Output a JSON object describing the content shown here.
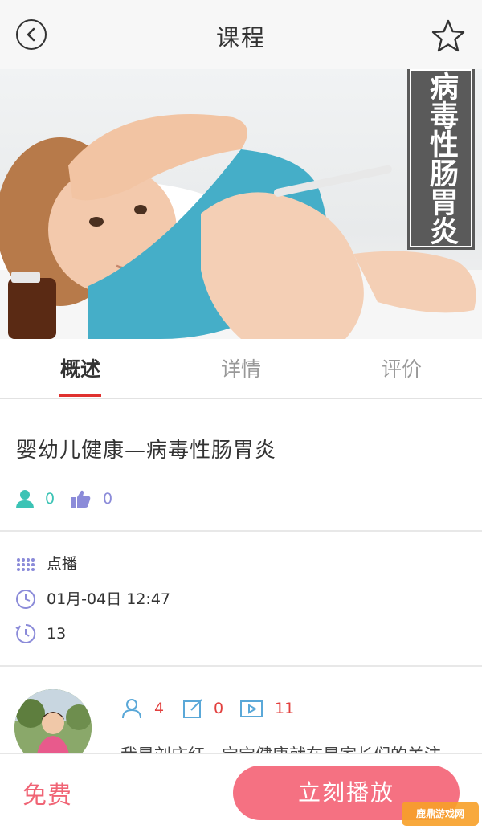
{
  "navbar": {
    "title": "课程",
    "back_icon": "back-arrow-icon",
    "favorite_icon": "star-icon"
  },
  "hero": {
    "label": "病毒性肠胃炎"
  },
  "tabs": [
    {
      "label": "概述",
      "active": true
    },
    {
      "label": "详情",
      "active": false
    },
    {
      "label": "评价",
      "active": false
    }
  ],
  "course": {
    "title": "婴幼儿健康—病毒性肠胃炎",
    "learners": "0",
    "likes": "0"
  },
  "info": {
    "type": "点播",
    "date": "01月-04日 12:47",
    "duration": "13"
  },
  "teacher": {
    "followers": "4",
    "notes": "0",
    "videos": "11",
    "intro_partial": "我是刘庆红，宝宝健康就在是家长们的关注"
  },
  "bottom": {
    "price": "免费",
    "play_label": "立刻播放"
  },
  "watermark": {
    "text": "鹿鼎游戏网"
  },
  "colors": {
    "accent_red": "#e0312f",
    "play_button": "#f57182",
    "price_text": "#f06475",
    "teal": "#3cc3b5",
    "purple": "#8b8bd9"
  }
}
